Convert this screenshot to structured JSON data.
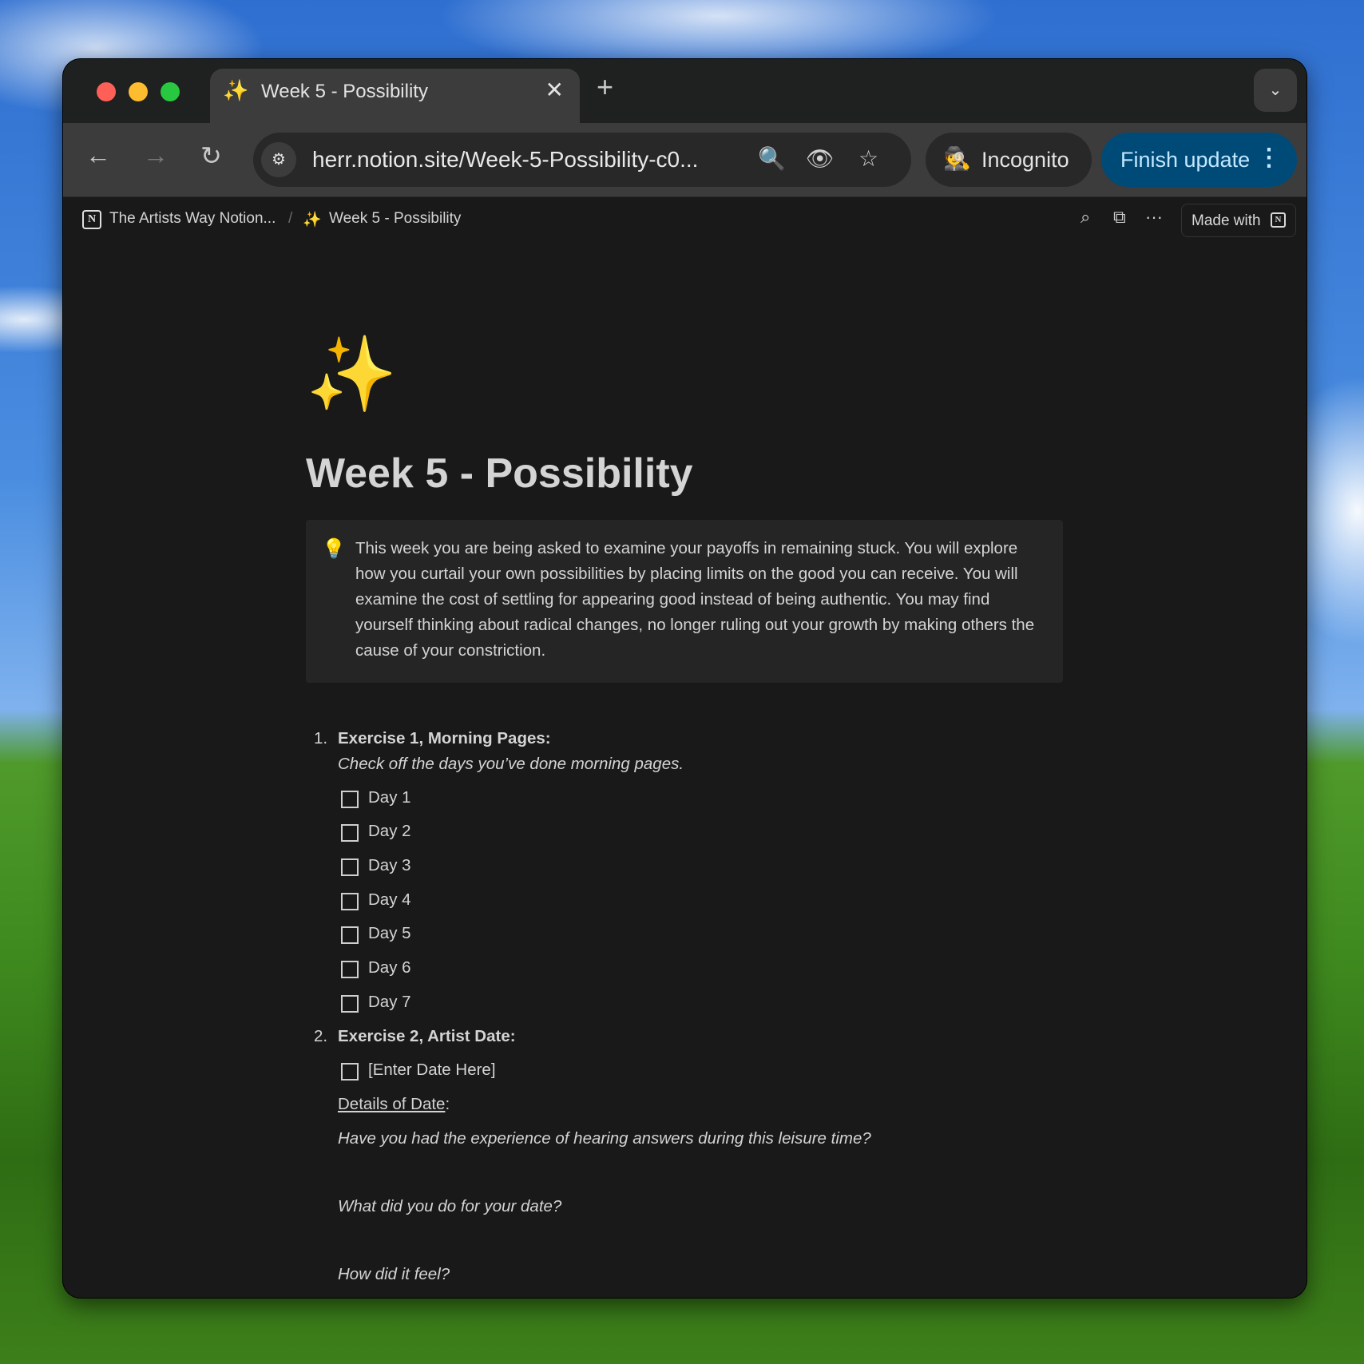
{
  "browser": {
    "tab": {
      "icon": "✨",
      "title": "Week 5 - Possibility",
      "close_icon": "✕"
    },
    "new_tab_icon": "+",
    "tab_menu_icon": "⌄",
    "nav": {
      "back_icon": "←",
      "forward_icon": "→",
      "reload_icon": "↻"
    },
    "omnibox": {
      "site_info_icon": "⚙",
      "url": "herr.notion.site/Week-5-Possibility-c0...",
      "zoom_icon": "🔍",
      "eye_off_icon": "👁",
      "star_icon": "☆"
    },
    "incognito": {
      "icon": "🕵",
      "label": "Incognito"
    },
    "finish_update": {
      "label": "Finish update",
      "menu_icon": "⋮"
    },
    "colors": {
      "accent": "#004a77",
      "accent_text": "#c2e7ff"
    }
  },
  "notion": {
    "breadcrumb": [
      {
        "icon": "N",
        "label": "The Artists Way Notion..."
      },
      {
        "separator": "/"
      },
      {
        "icon": "✨",
        "label": "Week 5 - Possibility"
      }
    ],
    "topbar": {
      "search_icon": "⌕",
      "duplicate_icon": "⧉",
      "more_icon": "···",
      "made_with_label": "Made with",
      "made_with_logo": "N"
    },
    "page": {
      "icon": "✨",
      "title": "Week 5 - Possibility",
      "callout": {
        "icon": "💡",
        "text": "This week you are being asked to examine your payoffs in remaining stuck. You will explore how you curtail your own possibilities by placing limits on the good you can receive. You will examine the cost of settling for appearing good instead of being authentic. You may find yourself thinking about radical changes, no longer ruling out your growth by making others the cause of your constriction."
      },
      "exercises": [
        {
          "number": "1.",
          "title": "Exercise 1, Morning Pages:",
          "subtitle": "Check off the days you’ve done morning pages.",
          "todos": [
            {
              "label": "Day 1",
              "checked": false
            },
            {
              "label": "Day 2",
              "checked": false
            },
            {
              "label": "Day 3",
              "checked": false
            },
            {
              "label": "Day 4",
              "checked": false
            },
            {
              "label": "Day 5",
              "checked": false
            },
            {
              "label": "Day 6",
              "checked": false
            },
            {
              "label": "Day 7",
              "checked": false
            }
          ]
        },
        {
          "number": "2.",
          "title": "Exercise 2, Artist Date:",
          "todos": [
            {
              "label": "[Enter Date Here]",
              "checked": false
            }
          ],
          "details_label": "Details of Date",
          "details_suffix": ":",
          "questions": [
            "Have you had the experience of hearing answers during this leisure time?",
            "What did you do for your date?",
            "How did it feel?"
          ]
        }
      ]
    }
  }
}
